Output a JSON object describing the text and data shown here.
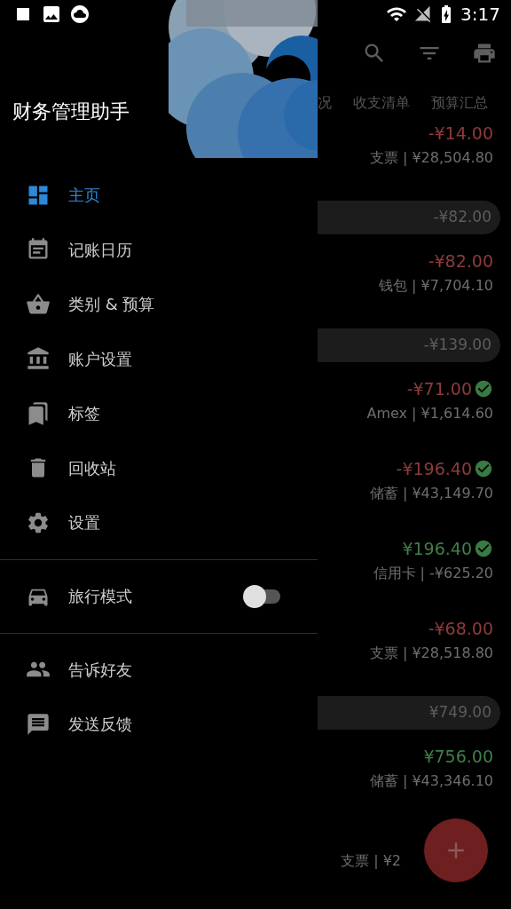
{
  "status_bar": {
    "time": "3:17"
  },
  "drawer": {
    "title": "财务管理助手",
    "menu": [
      {
        "label": "主页",
        "selected": true
      },
      {
        "label": "记账日历",
        "selected": false
      },
      {
        "label": "类别 & 预算",
        "selected": false
      },
      {
        "label": "账户设置",
        "selected": false
      },
      {
        "label": "标签",
        "selected": false
      },
      {
        "label": "回收站",
        "selected": false
      },
      {
        "label": "设置",
        "selected": false
      }
    ],
    "travel_mode": {
      "label": "旅行模式",
      "on": false
    },
    "secondary": [
      {
        "label": "告诉好友"
      },
      {
        "label": "发送反馈"
      }
    ]
  },
  "main": {
    "tabs": [
      {
        "label": "况",
        "selected": false
      },
      {
        "label": "收支清单",
        "selected": false
      },
      {
        "label": "预算汇总",
        "selected": false
      }
    ],
    "list": [
      {
        "kind": "transaction",
        "income": false,
        "amount": "-¥14.00",
        "cleared": false,
        "account": "支票 | ¥28,504.80"
      },
      {
        "kind": "day_total",
        "amount": "-¥82.00"
      },
      {
        "kind": "transaction",
        "income": false,
        "amount": "-¥82.00",
        "cleared": false,
        "account": "钱包 | ¥7,704.10"
      },
      {
        "kind": "day_total",
        "amount": "-¥139.00"
      },
      {
        "kind": "transaction",
        "income": false,
        "amount": "-¥71.00",
        "cleared": true,
        "account": "Amex | ¥1,614.60"
      },
      {
        "kind": "transaction",
        "income": false,
        "amount": "-¥196.40",
        "cleared": true,
        "account": "储蓄 | ¥43,149.70"
      },
      {
        "kind": "transaction",
        "income": true,
        "amount": "¥196.40",
        "cleared": true,
        "account": "信用卡 | -¥625.20"
      },
      {
        "kind": "transaction",
        "income": false,
        "amount": "-¥68.00",
        "cleared": false,
        "account": "支票 | ¥28,518.80"
      },
      {
        "kind": "day_total",
        "amount": "¥749.00"
      },
      {
        "kind": "transaction",
        "income": true,
        "amount": "¥756.00",
        "cleared": false,
        "account": "储蓄 | ¥43,346.10"
      },
      {
        "kind": "transaction",
        "cleared": false,
        "account": "支票 | ¥2"
      }
    ]
  }
}
